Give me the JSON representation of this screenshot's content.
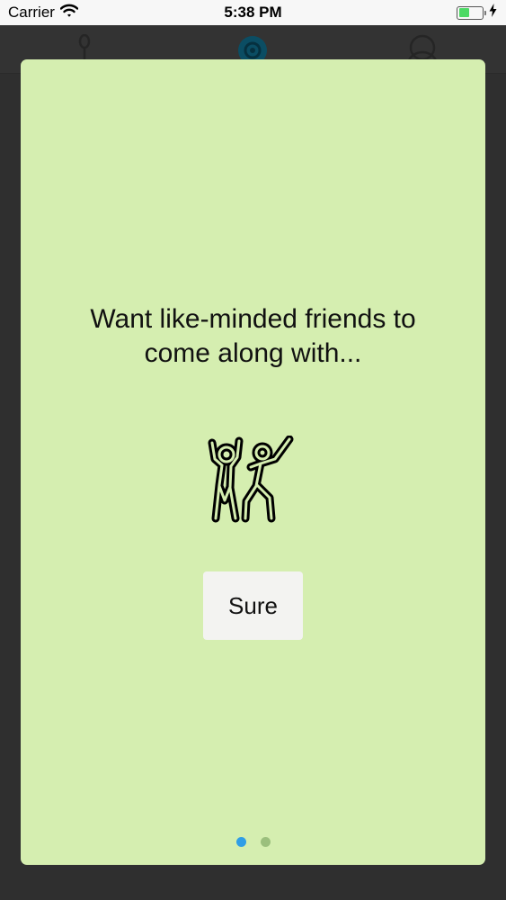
{
  "status_bar": {
    "carrier": "Carrier",
    "time": "5:38 PM",
    "battery_level": 0.45
  },
  "background_nav": {
    "icons": [
      "spoon-icon",
      "target-icon",
      "profile-icon"
    ]
  },
  "modal": {
    "headline": "Want like-minded friends to come along with...",
    "illustration_icon": "dancing-people-icon",
    "button_label": "Sure",
    "pager": {
      "pages": 2,
      "current": 1,
      "active_color": "#2f9ee6",
      "inactive_color": "#9bbf7d"
    }
  },
  "colors": {
    "modal_background": "#d5eeb0",
    "overlay_background": "#2f2f2f",
    "button_background": "#f3f3f1"
  }
}
